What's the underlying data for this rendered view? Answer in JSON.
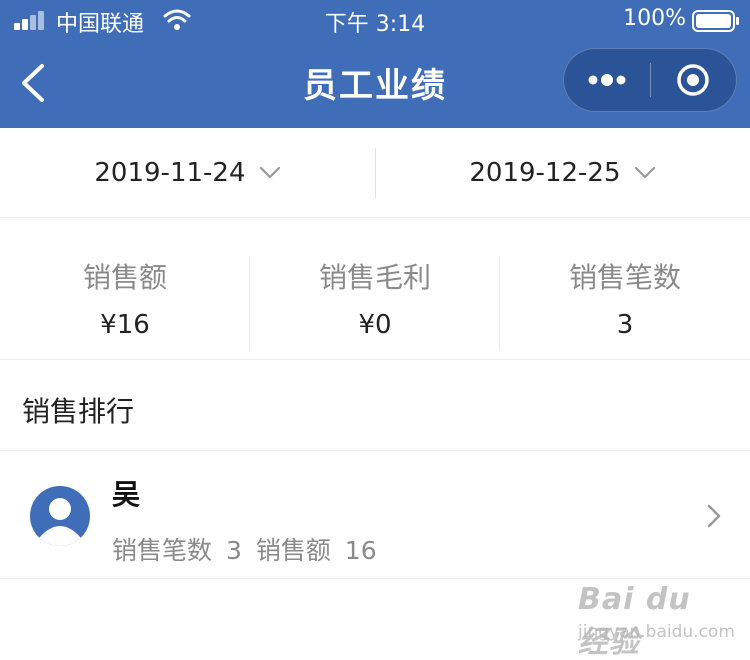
{
  "status_bar": {
    "carrier": "中国联通",
    "time": "下午 3:14",
    "battery": "100%"
  },
  "nav": {
    "title": "员工业绩",
    "back_icon": "chevron-left-icon",
    "more_icon": "more-dots-icon",
    "close_icon": "target-circle-icon"
  },
  "date_filter": {
    "start_date": "2019-11-24",
    "end_date": "2019-12-25"
  },
  "stats": [
    {
      "label": "销售额",
      "value": "¥16"
    },
    {
      "label": "销售毛利",
      "value": "¥0"
    },
    {
      "label": "销售笔数",
      "value": "3"
    }
  ],
  "ranking": {
    "title": "销售排行",
    "items": [
      {
        "name": "吴",
        "count_label": "销售笔数",
        "count": "3",
        "amount_label": "销售额",
        "amount": "16"
      }
    ]
  },
  "watermark": {
    "logo": "Bai du 经验",
    "url": "jingyan.baidu.com"
  },
  "colors": {
    "header_bg": "#3f6db8",
    "muted_text": "#8a8a8a",
    "avatar_bg": "#3f6db8"
  }
}
